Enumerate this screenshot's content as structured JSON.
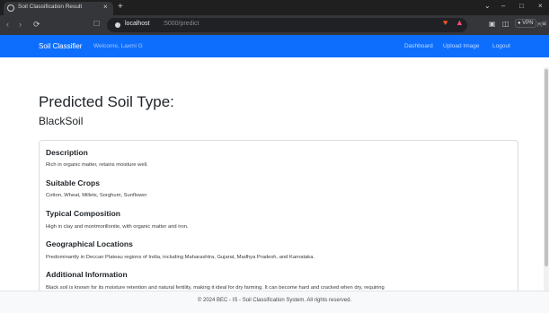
{
  "browser": {
    "tab_title": "Soil Classification Result",
    "tab_close": "×",
    "new_tab": "+",
    "address_host": "localhost",
    "address_path": ":5000/predict",
    "vpn_label": "VPN",
    "window_controls": [
      "⌄",
      "–",
      "□",
      "×"
    ],
    "icons": [
      "back-icon",
      "forward-icon",
      "reload-icon",
      "bookmark-icon",
      "share-icon",
      "brave-shield-icon",
      "rewards-icon",
      "sidebar-icon",
      "wallet-icon",
      "menu-icon"
    ]
  },
  "navbar": {
    "brand": "Soil Classifier",
    "welcome": "Welcome, Laxmi G",
    "links": [
      "Dashboard",
      "Upload Image",
      "Logout"
    ],
    "color": "#0d6efd"
  },
  "main": {
    "title": "Predicted Soil Type:",
    "soil_type": "BlackSoil",
    "sections": [
      {
        "heading": "Description",
        "text": "Rich in organic matter, retains moisture well."
      },
      {
        "heading": "Suitable Crops",
        "text": "Cotton, Wheat, Millets, Sorghum, Sunflower"
      },
      {
        "heading": "Typical Composition",
        "text": "High in clay and montmorillonite, with organic matter and iron."
      },
      {
        "heading": "Geographical Locations",
        "text": "Predominantly in Deccan Plateau regions of India, including Maharashtra, Gujarat, Madhya Pradesh, and Karnataka."
      },
      {
        "heading": "Additional Information",
        "text": "Black soil is known for its moisture retention and natural fertility, making it ideal for dry farming. It can become hard and cracked when dry, requiring"
      }
    ]
  },
  "footer": {
    "text": "© 2024 BEC - IS - Soil Classification System. All rights reserved."
  }
}
